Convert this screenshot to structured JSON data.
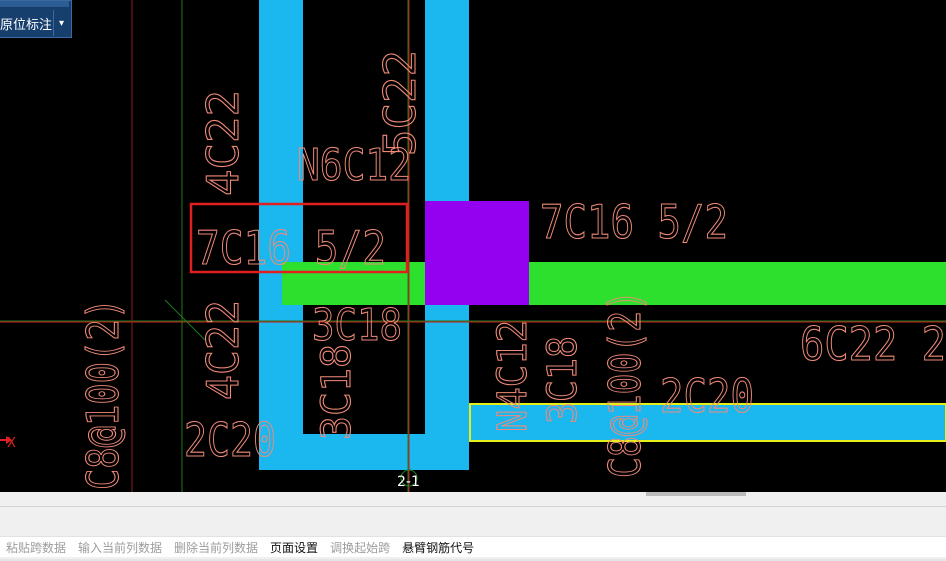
{
  "toolbar": {
    "label": "原位标注",
    "dropdown_icon": "chevron-down-icon"
  },
  "canvas": {
    "axis_label": "X",
    "section_marker": "2-1",
    "colors": {
      "background": "#000000",
      "beam_cyan": "#1bb8f0",
      "beam_green": "#2ee02e",
      "column_purple": "#9400f0",
      "text_salmon": "#f08a78",
      "selection_red": "#e02020",
      "highlight_yellow": "#e6f018"
    },
    "annotations": {
      "a1": "5C22",
      "a2": "4C22",
      "a3": "N6C12",
      "a4": "7C16  5/2",
      "a5": "7C16  5/2",
      "a6": "3C18",
      "a7": "C8@100(2)",
      "a8": "4C22",
      "a9": "2C20",
      "a10": "3C18",
      "a11": "N4C12",
      "a12": "3C18",
      "a13": "C8@100(2)",
      "a14": "2C20",
      "a15": "6C22  2"
    }
  },
  "menu": {
    "items": [
      {
        "label": "粘贴跨数据",
        "enabled": false
      },
      {
        "label": "输入当前列数据",
        "enabled": false
      },
      {
        "label": "删除当前列数据",
        "enabled": false
      },
      {
        "label": "页面设置",
        "enabled": true
      },
      {
        "label": "调换起始跨",
        "enabled": false
      },
      {
        "label": "悬臂钢筋代号",
        "enabled": true
      }
    ]
  }
}
